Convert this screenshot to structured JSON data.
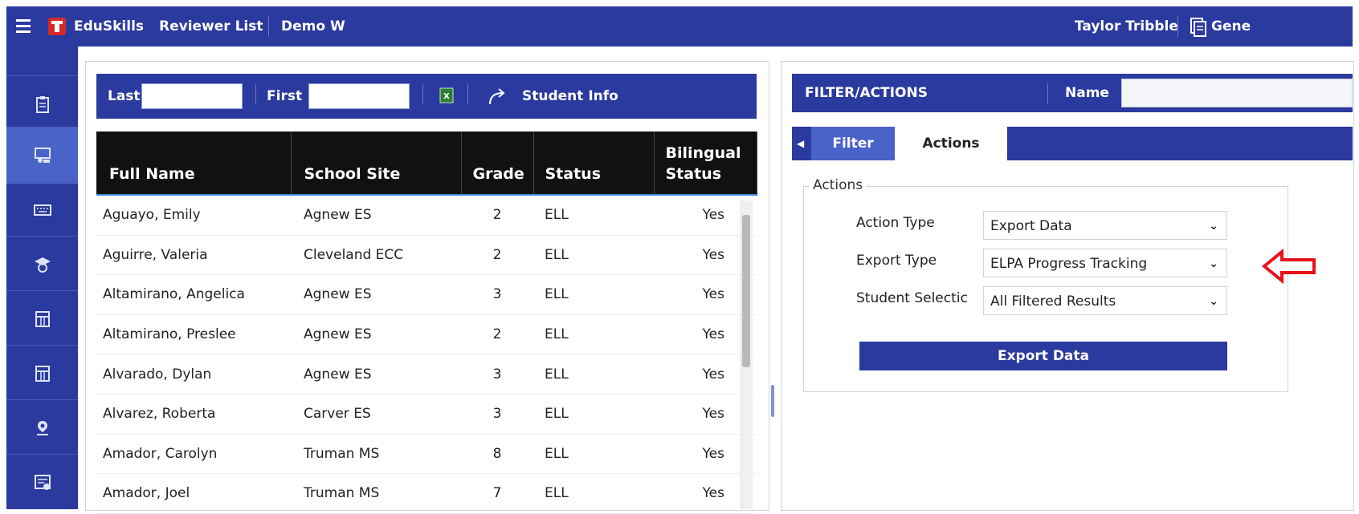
{
  "header": {
    "app_name": "EduSkills",
    "section": "Reviewer List",
    "district": "Demo W",
    "user": "Taylor Tribble",
    "right_link": "Gene"
  },
  "sidebar": {
    "items": [
      {
        "icon": "clipboard-icon"
      },
      {
        "icon": "teacher-icon"
      },
      {
        "icon": "keyboard-icon"
      },
      {
        "icon": "student-icon"
      },
      {
        "icon": "building-icon"
      },
      {
        "icon": "building-icon"
      },
      {
        "icon": "map-pin-icon"
      },
      {
        "icon": "report-icon"
      }
    ]
  },
  "search": {
    "last_label": "Last",
    "first_label": "First",
    "last_value": "",
    "first_value": "",
    "student_info_label": "Student Info"
  },
  "table": {
    "columns": [
      "Full Name",
      "School Site",
      "Grade",
      "Status",
      "Bilingual Status"
    ],
    "rows": [
      [
        "Aguayo, Emily",
        "Agnew ES",
        "2",
        "ELL",
        "Yes"
      ],
      [
        "Aguirre, Valeria",
        "Cleveland ECC",
        "2",
        "ELL",
        "Yes"
      ],
      [
        "Altamirano, Angelica",
        "Agnew ES",
        "3",
        "ELL",
        "Yes"
      ],
      [
        "Altamirano, Preslee",
        "Agnew ES",
        "2",
        "ELL",
        "Yes"
      ],
      [
        "Alvarado, Dylan",
        "Agnew ES",
        "3",
        "ELL",
        "Yes"
      ],
      [
        "Alvarez, Roberta",
        "Carver ES",
        "3",
        "ELL",
        "Yes"
      ],
      [
        "Amador, Carolyn",
        "Truman MS",
        "8",
        "ELL",
        "Yes"
      ],
      [
        "Amador, Joel",
        "Truman MS",
        "7",
        "ELL",
        "Yes"
      ]
    ]
  },
  "filter_panel": {
    "title": "FILTER/ACTIONS",
    "name_label": "Name",
    "tabs": [
      "Filter",
      "Actions"
    ],
    "actions_legend": "Actions",
    "action_type_label": "Action Type",
    "action_type_value": "Export Data",
    "export_type_label": "Export Type",
    "export_type_value": "ELPA Progress Tracking",
    "student_selection_label": "Student Selectic",
    "student_selection_value": "All Filtered Results",
    "export_button": "Export Data"
  },
  "colors": {
    "primary": "#2b3a9e",
    "table_header": "#111111",
    "arrow": "#e8121b"
  }
}
